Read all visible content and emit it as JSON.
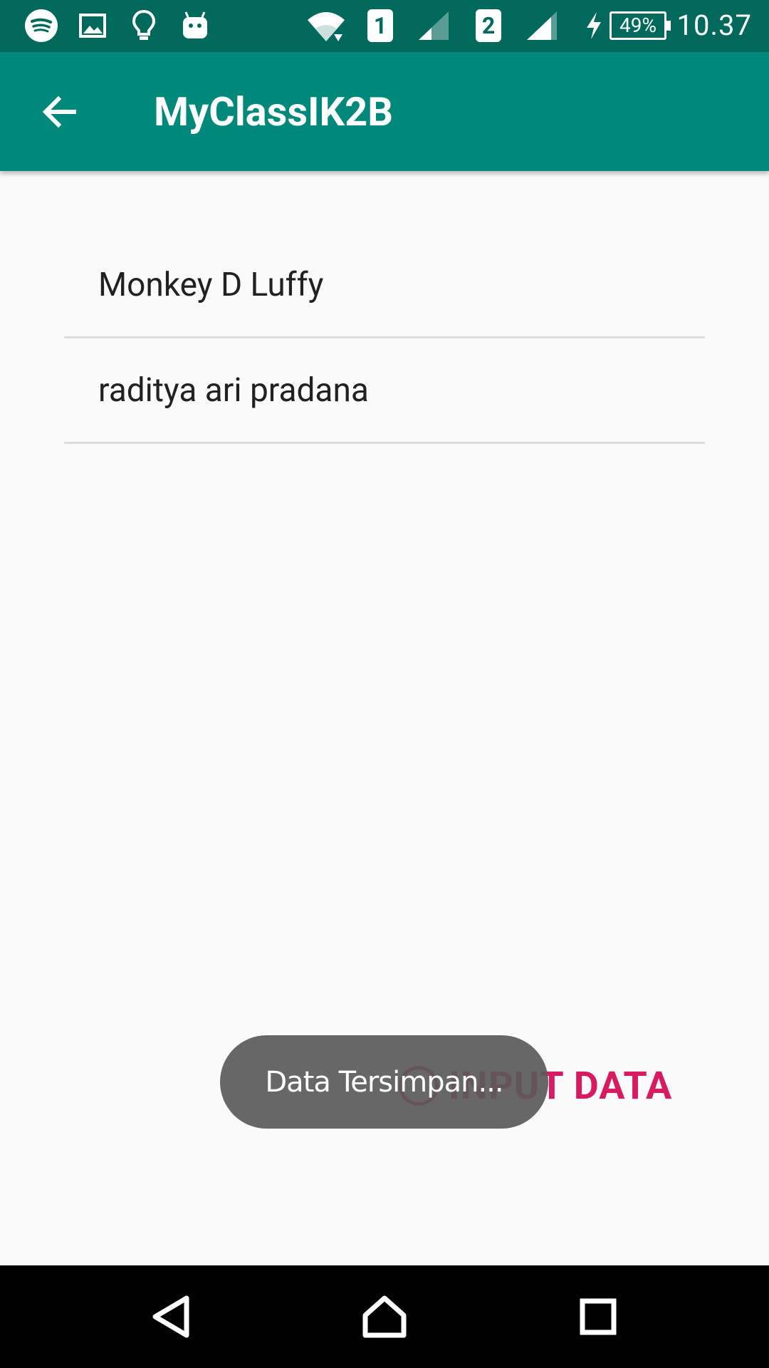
{
  "status_bar": {
    "time": "10.37",
    "battery": "49%",
    "sim1": "1",
    "sim2": "2",
    "icons": [
      "spotify-icon",
      "gallery-icon",
      "bulb-icon",
      "android-icon",
      "wifi-icon",
      "signal-icon",
      "signal-icon",
      "charging-icon"
    ]
  },
  "app_bar": {
    "title": "MyClassIK2B",
    "background": "#00897b",
    "status_background": "#00695c"
  },
  "list": {
    "items": [
      {
        "label": "Monkey D Luffy"
      },
      {
        "label": "raditya ari pradana"
      }
    ]
  },
  "input_button": {
    "label": "INPUT DATA",
    "color": "#d81b60"
  },
  "toast": {
    "message": "Data Tersimpan..."
  }
}
